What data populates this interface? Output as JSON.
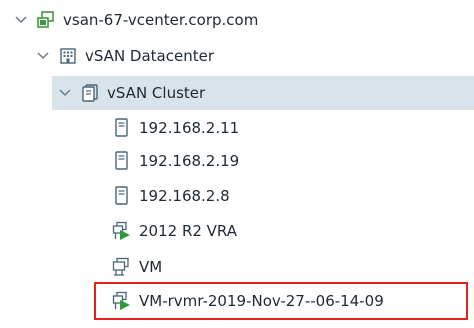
{
  "tree": {
    "vcenter": {
      "label": "vsan-67-vcenter.corp.com",
      "icon": "vcenter-icon"
    },
    "datacenter": {
      "label": "vSAN Datacenter",
      "icon": "datacenter-icon"
    },
    "cluster": {
      "label": "vSAN Cluster",
      "icon": "cluster-icon"
    },
    "hosts": [
      {
        "label": "192.168.2.11",
        "icon": "host-icon"
      },
      {
        "label": "192.168.2.19",
        "icon": "host-icon"
      },
      {
        "label": "192.168.2.8",
        "icon": "host-icon"
      }
    ],
    "vms": [
      {
        "label": "2012 R2 VRA",
        "icon": "vm-powered-on-icon"
      },
      {
        "label": "VM",
        "icon": "vm-icon"
      },
      {
        "label": "VM-rvmr-2019-Nov-27--06-14-09",
        "icon": "vm-powered-on-icon"
      }
    ]
  },
  "colors": {
    "selected_row": "#d9e4ea",
    "highlight_border": "#e0241c",
    "vcenter_green": "#3a9a3c",
    "power_on_green": "#2e9b3a"
  }
}
